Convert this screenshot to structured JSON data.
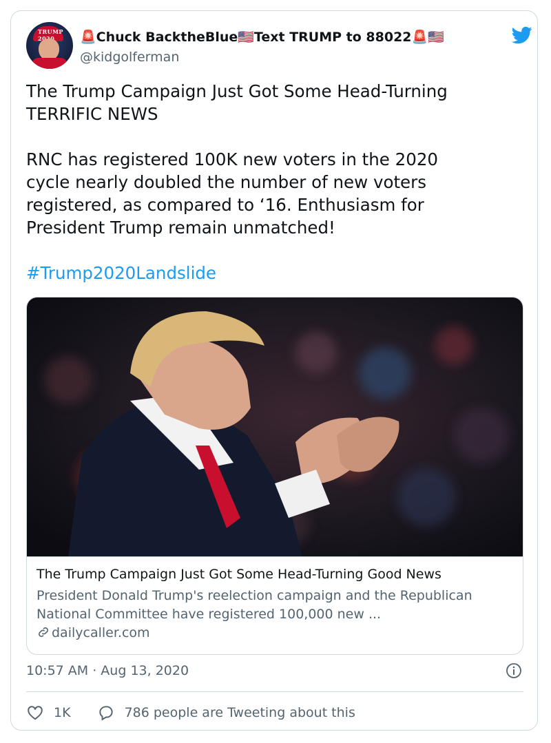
{
  "author": {
    "avatar_alt": "Profile photo",
    "display_name": "🚨Chuck BacktheBlue🇺🇸Text TRUMP to 88022🚨🇺🇸",
    "handle": "@kidgolferman",
    "avatar_hat_text": "TRUMP 2020"
  },
  "tweet": {
    "text": "The Trump Campaign Just Got Some Head-Turning\nTERRIFIC NEWS\n\nRNC has registered 100K new voters in the 2020\ncycle nearly doubled the number of new voters\nregistered, as compared to ‘16. Enthusiasm for\nPresident Trump remain unmatched!",
    "hashtag": "#Trump2020Landslide",
    "timestamp": "10:57 AM · Aug 13, 2020"
  },
  "link_card": {
    "title": "The Trump Campaign Just Got Some Head-Turning Good News",
    "description": "President Donald Trump's reelection campaign and the Republican National Committee have registered 100,000 new ...",
    "domain": "dailycaller.com"
  },
  "actions": {
    "like_count": "1K",
    "reply_text": "786 people are Tweeting about this"
  },
  "colors": {
    "accent": "#1d9bf0",
    "secondary_text": "#536471",
    "border": "#cfd9de",
    "like_icon": "#536471"
  },
  "icons": [
    "twitter-bird-icon",
    "link-icon",
    "info-icon",
    "heart-icon",
    "comment-icon"
  ]
}
